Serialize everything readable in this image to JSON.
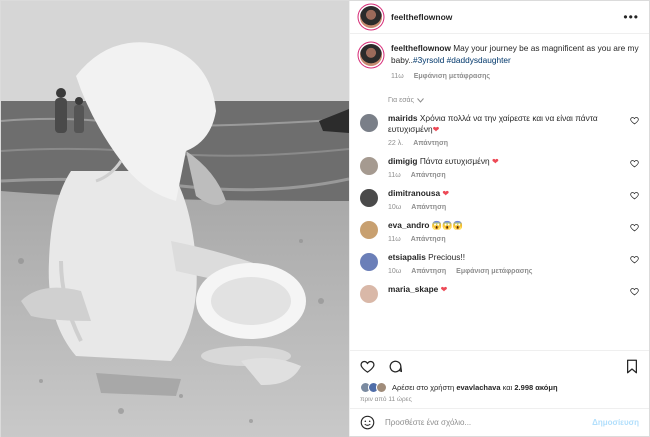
{
  "post": {
    "username": "feeltheflownow",
    "caption_text": "May your journey be as magnificent as you are my baby..",
    "hashtags": "#3yrsold #daddysdaughter",
    "caption_time": "11ω",
    "caption_translate": "Εμφάνιση μετάφρασης",
    "sort_label": "Για εσάς"
  },
  "comments": [
    {
      "user": "mairids",
      "text": "Χρόνια πολλά να την χαίρεστε και να είναι πάντα ευτυχισμένη",
      "heart": "❤",
      "time": "22 λ.",
      "reply": "Απάντηση",
      "translate": "",
      "avatar_color": "#7a7f88"
    },
    {
      "user": "dimigig",
      "text": "Πάντα ευτυχισμένη",
      "heart": "❤",
      "time": "11ω",
      "reply": "Απάντηση",
      "translate": "",
      "avatar_color": "#a59a90"
    },
    {
      "user": "dimitranousa",
      "text": "",
      "heart": "❤",
      "time": "10ω",
      "reply": "Απάντηση",
      "translate": "",
      "avatar_color": "#4a4a4a"
    },
    {
      "user": "eva_andro",
      "text": "😱😱😱",
      "heart": "",
      "time": "11ω",
      "reply": "Απάντηση",
      "translate": "",
      "avatar_color": "#c8a070"
    },
    {
      "user": "etsiapalis",
      "text": "Precious!!",
      "heart": "",
      "time": "10ω",
      "reply": "Απάντηση",
      "translate": "Εμφάνιση μετάφρασης",
      "avatar_color": "#6b7fb8"
    },
    {
      "user": "maria_skape",
      "text": "",
      "heart": "❤",
      "time": "",
      "reply": "",
      "translate": "",
      "avatar_color": "#d9b8a8"
    }
  ],
  "likes": {
    "prefix": "Αρέσει στο χρήστη",
    "user": "evavlachava",
    "middle": "και",
    "count": "2.998 ακόμη",
    "avatar_colors": [
      "#7a8aa0",
      "#4f6da8",
      "#a08c7a"
    ]
  },
  "posted_when": "πριν από 11 ώρες",
  "add_comment": {
    "placeholder": "Προσθέστε ένα σχόλιο...",
    "post_label": "Δημοσίευση"
  }
}
